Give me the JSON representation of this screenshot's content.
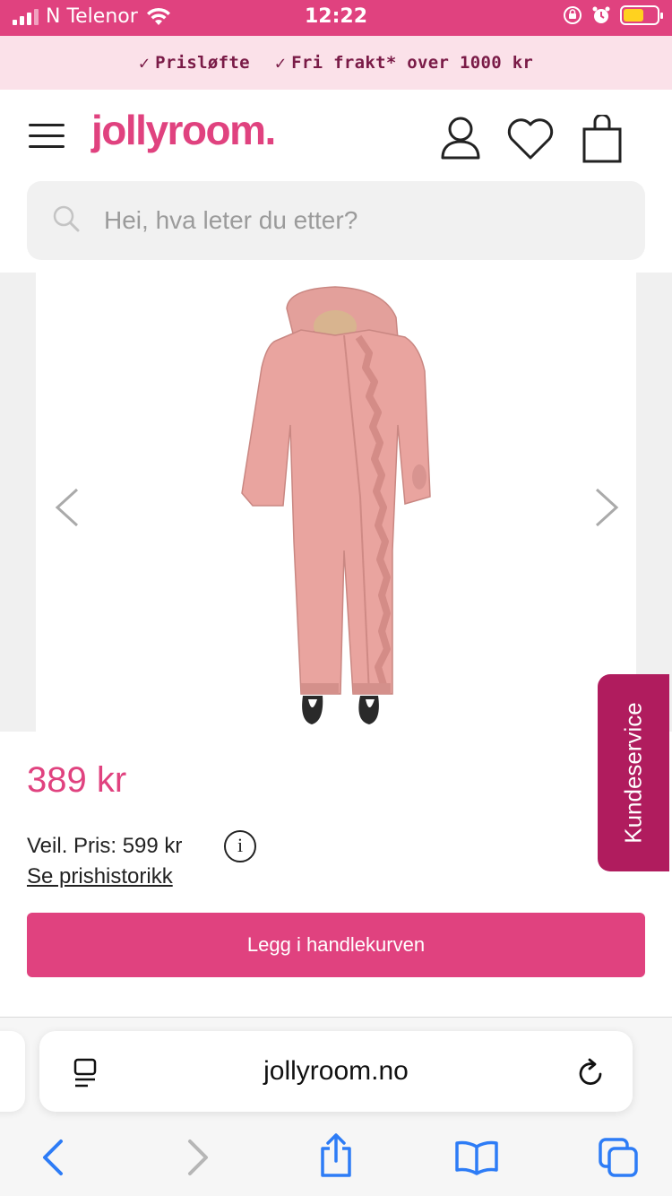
{
  "status": {
    "carrier": "N Telenor",
    "time": "12:22"
  },
  "promo": {
    "items": [
      "Prisløfte",
      "Fri frakt* over 1000 kr"
    ]
  },
  "header": {
    "logo": "jollyroom."
  },
  "search": {
    "placeholder": "Hei, hva leter du etter?"
  },
  "product": {
    "price": "389 kr",
    "recommended_price": "Veil. Pris: 599 kr",
    "price_history_link": "Se prishistorikk",
    "add_to_cart": "Legg i handlekurven",
    "image_color": "#e9a49f"
  },
  "support": {
    "label": "Kundeservice"
  },
  "browser": {
    "url": "jollyroom.no"
  },
  "colors": {
    "brand": "#e0427f",
    "promo_bg": "#fbe1e9",
    "support_tab": "#b01c5e",
    "ios_blue": "#2d7cf6"
  }
}
